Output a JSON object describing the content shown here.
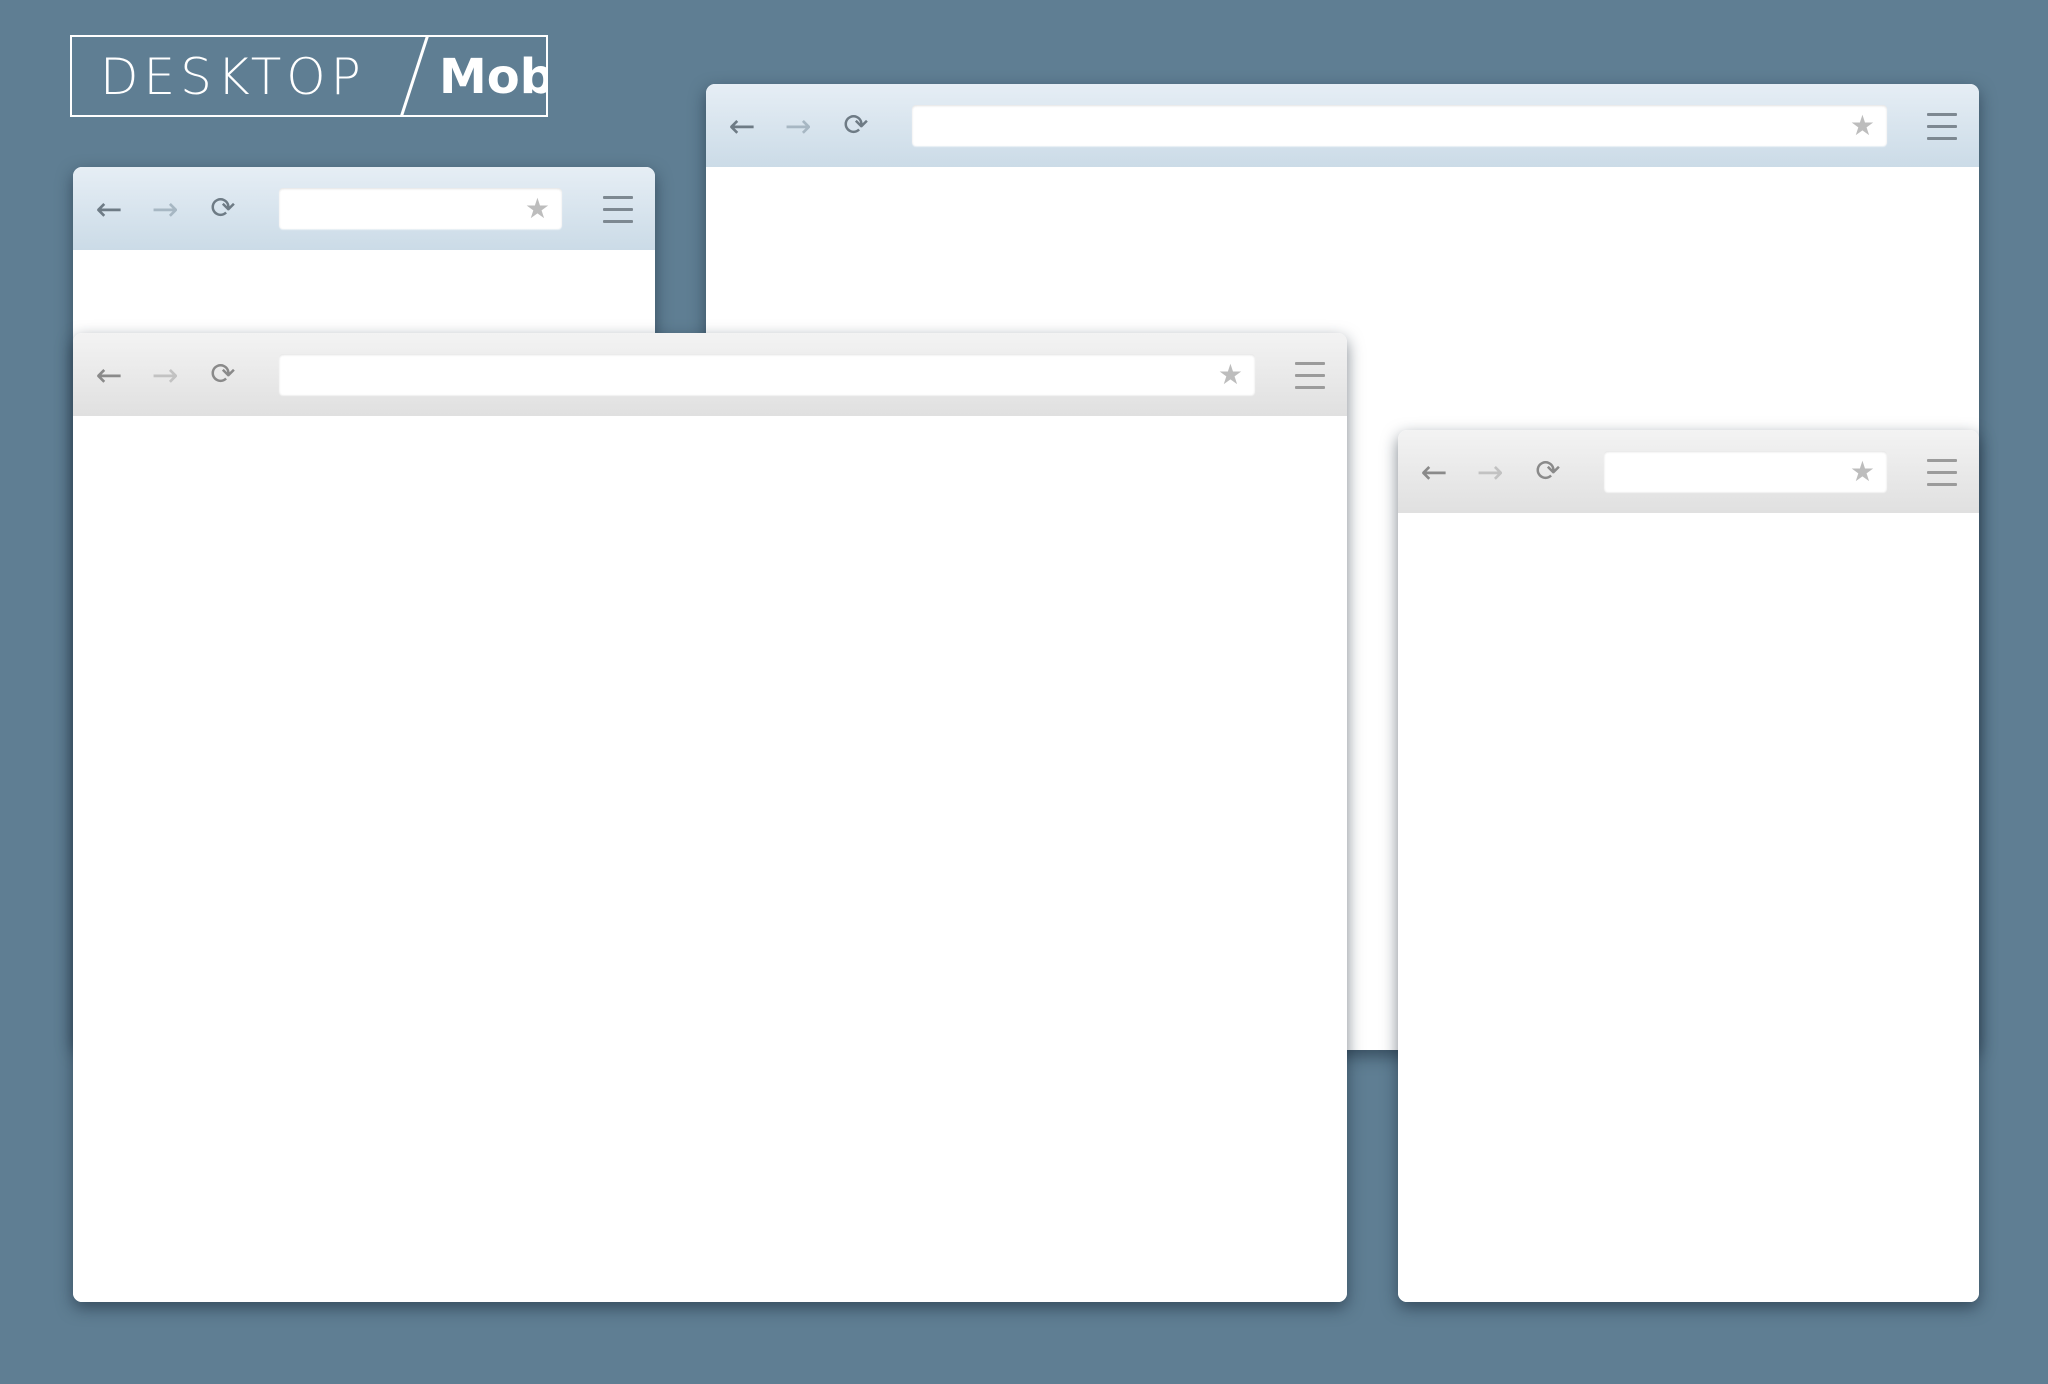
{
  "logo": {
    "desktop_text": "DESKTOP",
    "mobile_text": "Mobile"
  },
  "icons": {
    "back": "←",
    "forward": "→",
    "reload": "⟳",
    "bookmark": "★"
  },
  "colors": {
    "background": "#5f7e93",
    "toolbar_blue": "#cbdbe7",
    "toolbar_gray": "#e0e0e0",
    "window": "#ffffff"
  },
  "windows": [
    {
      "id": "small-blue-window",
      "theme": "blue",
      "address_value": ""
    },
    {
      "id": "large-blue-window",
      "theme": "blue",
      "address_value": ""
    },
    {
      "id": "large-gray-window",
      "theme": "gray",
      "address_value": ""
    },
    {
      "id": "small-gray-window",
      "theme": "gray",
      "address_value": ""
    }
  ]
}
